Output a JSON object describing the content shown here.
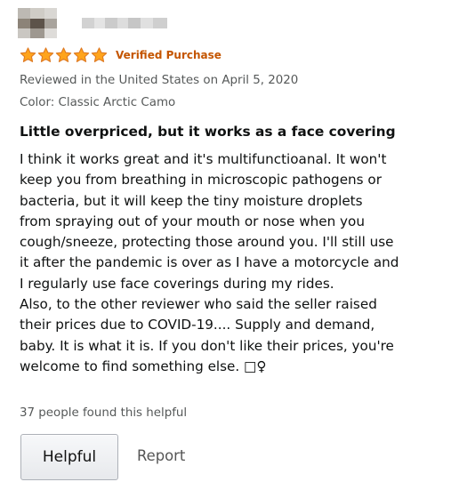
{
  "review": {
    "rating": 5,
    "rating_max": 5,
    "verified_label": "Verified Purchase",
    "reviewed_in": "Reviewed in the United States on April 5, 2020",
    "color_variant": "Color: Classic Arctic Camo",
    "title": "Little overpriced, but it works as a face covering",
    "body_lines": [
      "I think it works great and it's multifunctioanal. It won't",
      "keep you from breathing in microscopic pathogens or",
      "bacteria, but it will keep the tiny moisture droplets",
      "from spraying out of your mouth or nose when you",
      "cough/sneeze, protecting those around you. I'll still use",
      "it after the pandemic is over as I have a motorcycle and",
      "I regularly use face coverings during my rides.",
      "Also, to the other reviewer who said the seller raised",
      "their prices due to COVID-19.... Supply and demand,",
      "baby. It is what it is. If you don't like their prices, you're",
      "welcome to find something else. □♀"
    ],
    "helpful_count": "37 people found this helpful",
    "helpful_button": "Helpful",
    "report_link": "Report"
  },
  "colors": {
    "star": "#ffa41c",
    "star_outline": "#de7921",
    "verified": "#c45500",
    "meta_text": "#565959"
  },
  "icons": {
    "avatar": "blurred-avatar-icon",
    "star": "star-icon"
  }
}
